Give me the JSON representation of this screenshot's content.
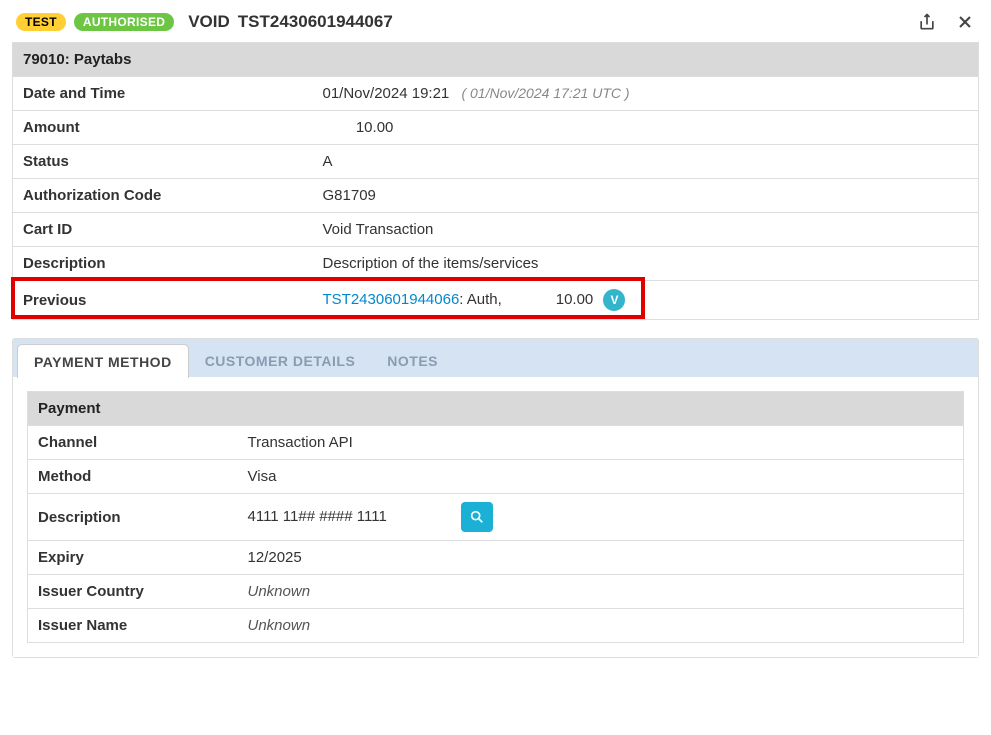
{
  "header": {
    "test_badge": "TEST",
    "auth_badge": "AUTHORISED",
    "void_label": "VOID",
    "txn_ref": "TST2430601944067"
  },
  "merchant_header": "79010: Paytabs",
  "details": {
    "date_label": "Date and Time",
    "date_value": "01/Nov/2024 19:21",
    "date_utc": "( 01/Nov/2024 17:21 UTC )",
    "amount_label": "Amount",
    "amount_value": "10.00",
    "status_label": "Status",
    "status_value": "A",
    "auth_code_label": "Authorization Code",
    "auth_code_value": "G81709",
    "cart_label": "Cart ID",
    "cart_value": "Void Transaction",
    "desc_label": "Description",
    "desc_value": "Description of the items/services",
    "prev_label": "Previous",
    "prev_link": "TST2430601944066",
    "prev_status": ": Auth,",
    "prev_amount": "10.00",
    "prev_badge": "V"
  },
  "tabs": {
    "payment_method": "PAYMENT METHOD",
    "customer_details": "CUSTOMER DETAILS",
    "notes": "NOTES"
  },
  "payment": {
    "header": "Payment",
    "channel_label": "Channel",
    "channel_value": "Transaction API",
    "method_label": "Method",
    "method_value": "Visa",
    "desc_label": "Description",
    "desc_value": "4111 11## #### 1111",
    "expiry_label": "Expiry",
    "expiry_value": "12/2025",
    "issuer_country_label": "Issuer Country",
    "issuer_country_value": "Unknown",
    "issuer_name_label": "Issuer Name",
    "issuer_name_value": "Unknown"
  }
}
